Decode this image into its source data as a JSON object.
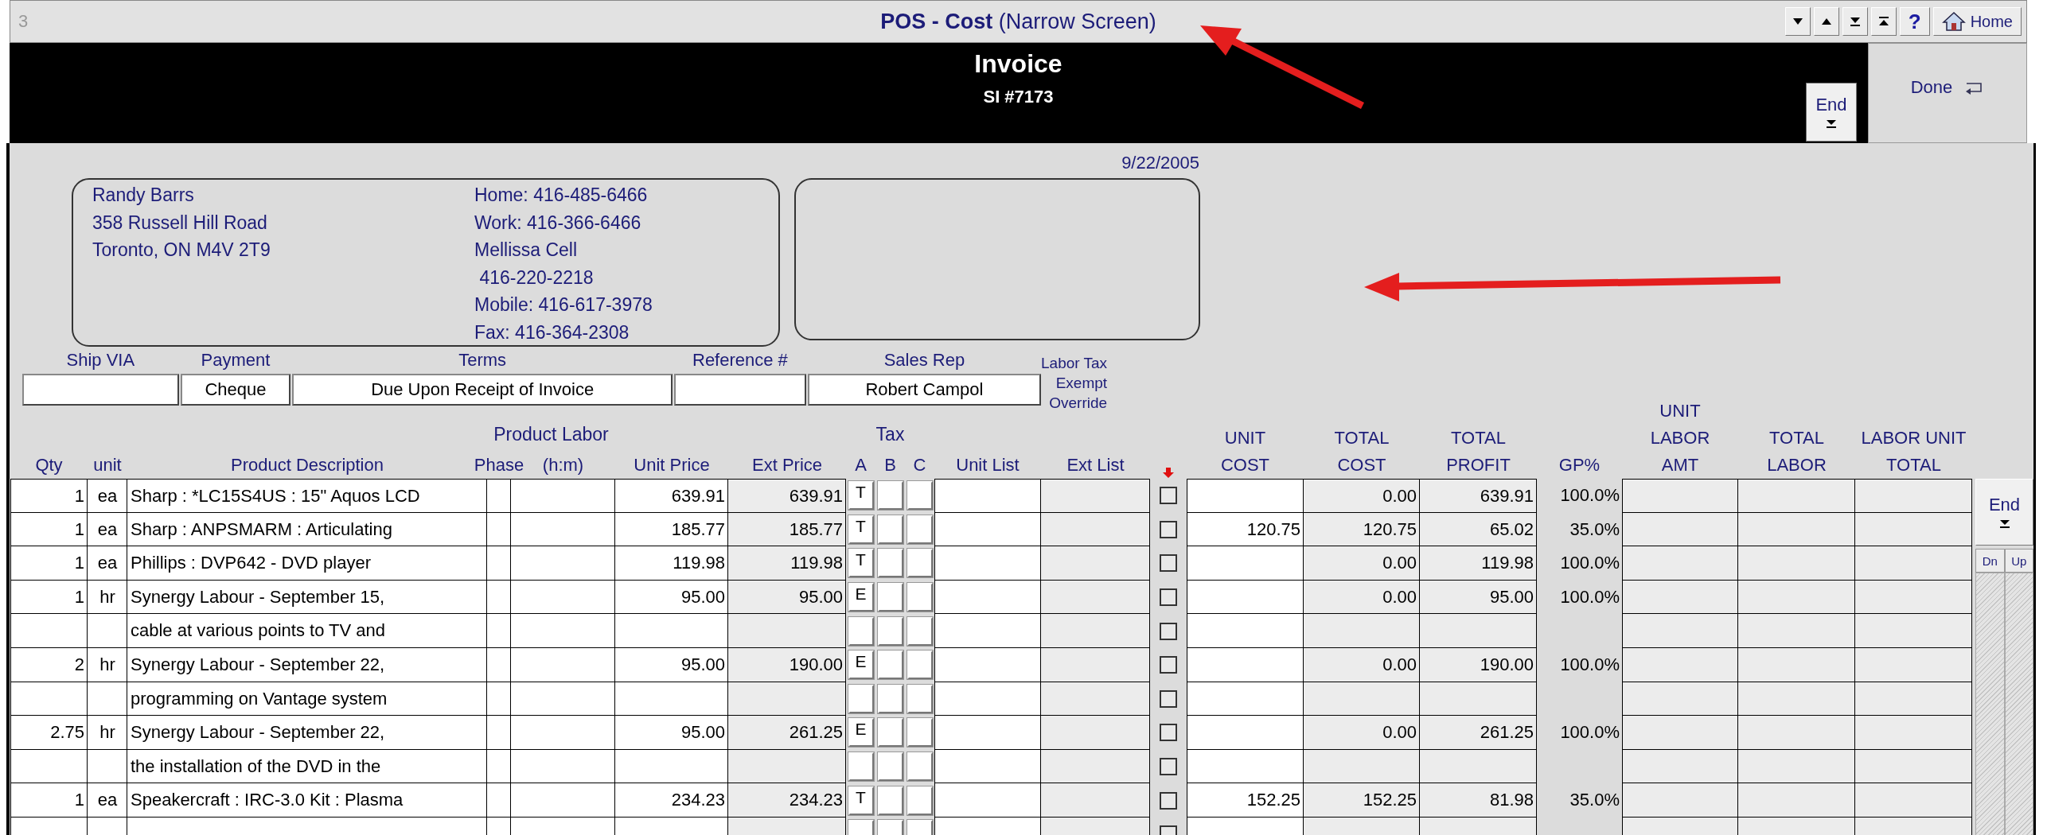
{
  "window": {
    "number": "3",
    "title": "**POS - Cost** (Narrow Screen)",
    "help_button": "?",
    "home_button": "Home"
  },
  "header": {
    "title": "Invoice",
    "invoice_number": "SI #7173",
    "end_button": "End",
    "done_button": "Done"
  },
  "date": "9/22/2005",
  "customer": {
    "address_lines": [
      "Randy Barrs",
      "358 Russell Hill Road",
      "Toronto, ON M4V 2T9"
    ],
    "phone_lines": [
      "Home: 416-485-6466",
      "Work: 416-366-6466",
      "Mellissa Cell",
      " 416-220-2218",
      "Mobile: 416-617-3978",
      "Fax: 416-364-2308"
    ]
  },
  "order_fields": [
    {
      "label": "Ship VIA"
    },
    {
      "label": "Payment",
      "value": "Cheque"
    },
    {
      "label": "Terms",
      "value": "Due Upon Receipt of Invoice"
    },
    {
      "label": "Reference #"
    },
    {
      "label": "Sales Rep",
      "value": "Robert Campol"
    }
  ],
  "labor_tax_override_label": [
    "Labor Tax",
    "Exempt",
    "Override"
  ],
  "group_headers": {
    "product_labor": "Product Labor",
    "tax": "Tax"
  },
  "columns": [
    {
      "kind": "text",
      "lines": [
        "Qty"
      ]
    },
    {
      "kind": "text",
      "lines": [
        "unit"
      ]
    },
    {
      "kind": "text",
      "lines": [
        "Product Description"
      ]
    },
    {
      "kind": "text",
      "lines": [
        "Phase"
      ]
    },
    {
      "kind": "text",
      "lines": [
        "(h:m)"
      ]
    },
    {
      "kind": "text",
      "lines": [
        "Unit Price"
      ]
    },
    {
      "kind": "text",
      "lines": [
        "Ext Price"
      ]
    },
    {
      "kind": "text",
      "lines": [
        "A"
      ]
    },
    {
      "kind": "text",
      "lines": [
        "B"
      ]
    },
    {
      "kind": "text",
      "lines": [
        "C"
      ]
    },
    {
      "kind": "text",
      "lines": [
        "Unit List"
      ]
    },
    {
      "kind": "text",
      "lines": [
        "Ext List"
      ]
    },
    {
      "kind": "arrow"
    },
    {
      "kind": "text",
      "lines": [
        "UNIT",
        "COST"
      ]
    },
    {
      "kind": "text",
      "lines": [
        "TOTAL",
        "COST"
      ]
    },
    {
      "kind": "text",
      "lines": [
        "TOTAL",
        "PROFIT"
      ]
    },
    {
      "kind": "text",
      "lines": [
        "GP%"
      ]
    },
    {
      "kind": "text",
      "lines": [
        "UNIT",
        "LABOR",
        "AMT"
      ]
    },
    {
      "kind": "text",
      "lines": [
        "TOTAL",
        "LABOR"
      ]
    },
    {
      "kind": "text",
      "lines": [
        "LABOR UNIT",
        "TOTAL"
      ]
    }
  ],
  "rows": [
    {
      "qty": "1",
      "unit": "ea",
      "description": "Sharp : *LC15S4US : 15\" Aquos LCD",
      "unit_price": "639.91",
      "ext_price": "639.91",
      "tax_a": "T",
      "override": false,
      "total_cost": "0.00",
      "total_profit": "639.91",
      "gp": "100.0%"
    },
    {
      "qty": "1",
      "unit": "ea",
      "description": "Sharp : ANPSMARM  : Articulating",
      "unit_price": "185.77",
      "ext_price": "185.77",
      "tax_a": "T",
      "override": false,
      "unit_cost": "120.75",
      "total_cost": "120.75",
      "total_profit": "65.02",
      "gp": "35.0%"
    },
    {
      "qty": "1",
      "unit": "ea",
      "description": "Phillips : DVP642 - DVD player",
      "unit_price": "119.98",
      "ext_price": "119.98",
      "tax_a": "T",
      "override": false,
      "total_cost": "0.00",
      "total_profit": "119.98",
      "gp": "100.0%"
    },
    {
      "qty": "1",
      "unit": "hr",
      "description": "Synergy Labour - September 15,",
      "unit_price": "95.00",
      "ext_price": "95.00",
      "tax_a": "E",
      "override": false,
      "total_cost": "0.00",
      "total_profit": "95.00",
      "gp": "100.0%"
    },
    {
      "description": "cable at various points to TV and",
      "override": false
    },
    {
      "qty": "2",
      "unit": "hr",
      "description": "Synergy Labour - September 22,",
      "unit_price": "95.00",
      "ext_price": "190.00",
      "tax_a": "E",
      "override": false,
      "total_cost": "0.00",
      "total_profit": "190.00",
      "gp": "100.0%"
    },
    {
      "description": "programming on Vantage system",
      "override": false
    },
    {
      "qty": "2.75",
      "unit": "hr",
      "description": "Synergy Labour - September 22,",
      "unit_price": "95.00",
      "ext_price": "261.25",
      "tax_a": "E",
      "override": false,
      "total_cost": "0.00",
      "total_profit": "261.25",
      "gp": "100.0%"
    },
    {
      "description": "the installation of the DVD in the",
      "override": false
    },
    {
      "qty": "1",
      "unit": "ea",
      "description": "Speakercraft : IRC-3.0 Kit : Plasma",
      "unit_price": "234.23",
      "ext_price": "234.23",
      "tax_a": "T",
      "override": false,
      "unit_cost": "152.25",
      "total_cost": "152.25",
      "total_profit": "81.98",
      "gp": "35.0%"
    },
    {
      "override": false
    }
  ],
  "scroll": {
    "end_button": "End",
    "down_button": "Dn",
    "up_button": "Up"
  }
}
